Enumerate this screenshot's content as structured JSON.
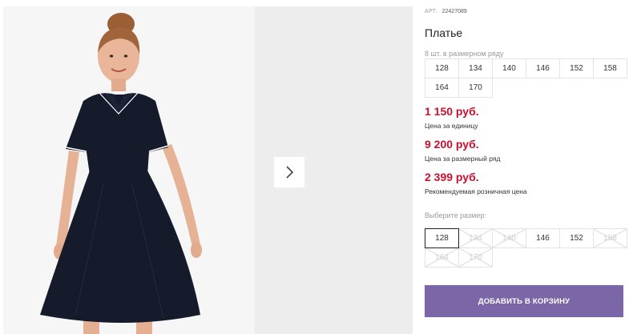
{
  "gallery": {
    "next_icon": "chevron-right-icon"
  },
  "product": {
    "article_label": "АРТ.",
    "article_value": "22427089",
    "title": "Платье",
    "pack_note": "8 шт. в размерном ряду",
    "pack_sizes": [
      "128",
      "134",
      "140",
      "146",
      "152",
      "158",
      "164",
      "170"
    ],
    "prices": [
      {
        "amount": "1 150 руб.",
        "caption": "Цена за единицу"
      },
      {
        "amount": "9 200 руб.",
        "caption": "Цена за размерный ряд"
      },
      {
        "amount": "2 399 руб.",
        "caption": "Рекомендуемая розничная цена"
      }
    ],
    "choose_label": "Выберите размер:",
    "size_options": [
      {
        "label": "128",
        "state": "selected"
      },
      {
        "label": "134",
        "state": "disabled"
      },
      {
        "label": "140",
        "state": "disabled"
      },
      {
        "label": "146",
        "state": "available"
      },
      {
        "label": "152",
        "state": "available"
      },
      {
        "label": "158",
        "state": "disabled"
      },
      {
        "label": "164",
        "state": "disabled"
      },
      {
        "label": "170",
        "state": "disabled"
      }
    ],
    "add_to_cart_label": "ДОБАВИТЬ В КОРЗИНУ"
  },
  "colors": {
    "price_red": "#c8102e",
    "button_purple": "#7b66a8",
    "dress_navy": "#161b2c"
  }
}
